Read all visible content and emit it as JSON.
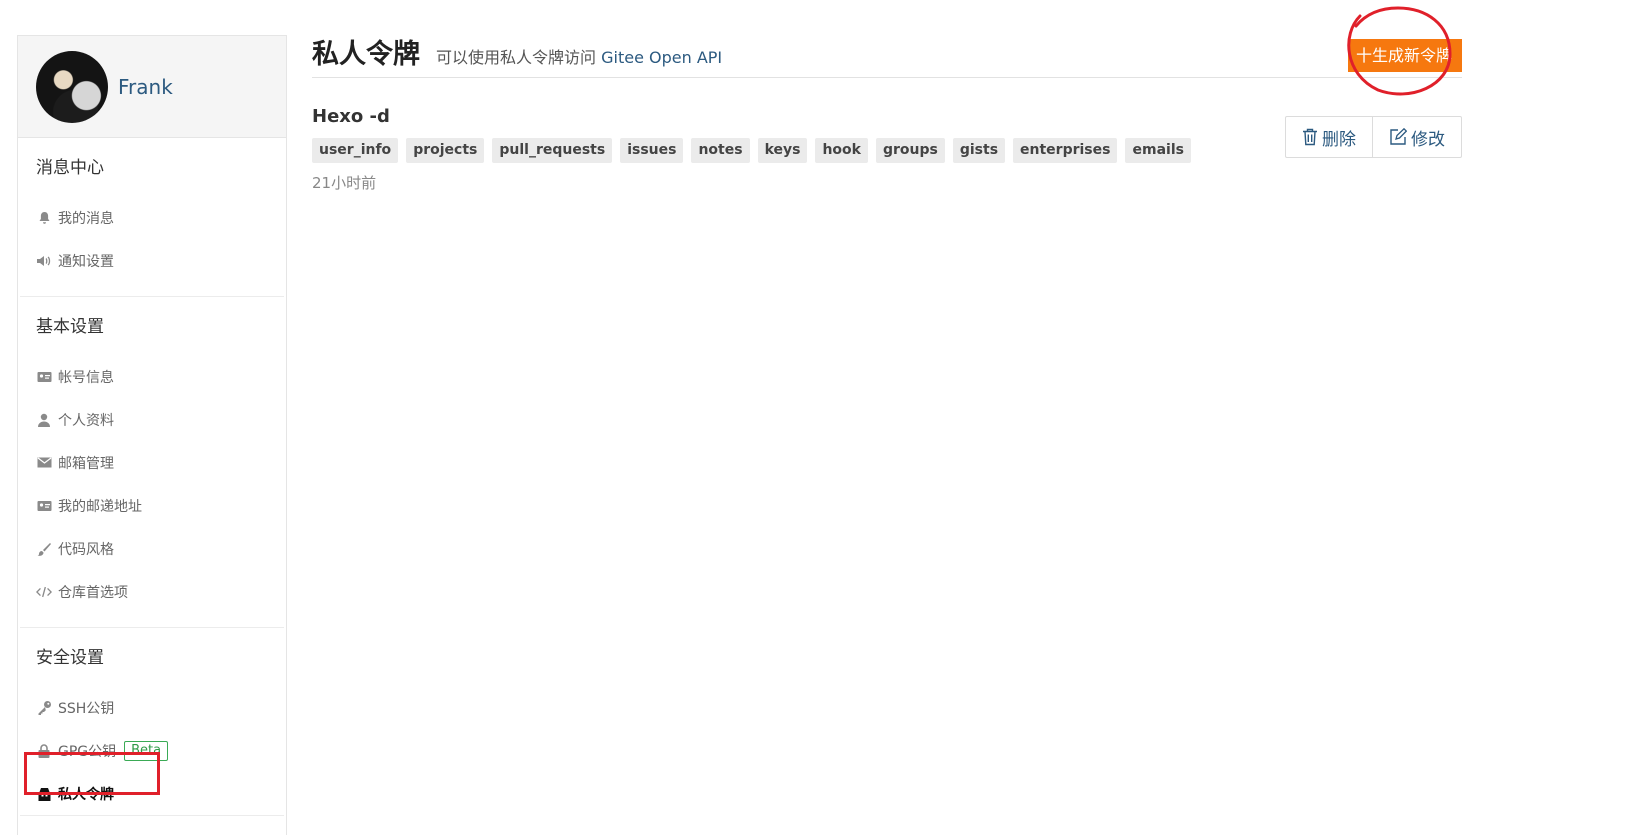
{
  "user": {
    "name": "Frank"
  },
  "sidebar": {
    "sections": [
      {
        "title": "消息中心",
        "items": [
          {
            "label": "我的消息",
            "icon": "bell-icon"
          },
          {
            "label": "通知设置",
            "icon": "speaker-icon"
          }
        ]
      },
      {
        "title": "基本设置",
        "items": [
          {
            "label": "帐号信息",
            "icon": "id-card-icon"
          },
          {
            "label": "个人资料",
            "icon": "user-icon"
          },
          {
            "label": "邮箱管理",
            "icon": "envelope-icon"
          },
          {
            "label": "我的邮递地址",
            "icon": "address-card-icon"
          },
          {
            "label": "代码风格",
            "icon": "brush-icon"
          },
          {
            "label": "仓库首选项",
            "icon": "code-icon"
          }
        ]
      },
      {
        "title": "安全设置",
        "items": [
          {
            "label": "SSH公钥",
            "icon": "key-icon"
          },
          {
            "label": "GPG公钥",
            "icon": "lock-icon",
            "badge": "Beta"
          },
          {
            "label": "私人令牌",
            "icon": "token-icon",
            "active": true
          }
        ]
      }
    ]
  },
  "header": {
    "title": "私人令牌",
    "subtitle_prefix": "可以使用私人令牌访问",
    "subtitle_link": "Gitee Open API",
    "generate_button": "十生成新令牌"
  },
  "tokens": [
    {
      "name": "Hexo -d",
      "scopes": [
        "user_info",
        "projects",
        "pull_requests",
        "issues",
        "notes",
        "keys",
        "hook",
        "groups",
        "gists",
        "enterprises",
        "emails"
      ],
      "time": "21小时前",
      "delete_label": "删除",
      "edit_label": "修改"
    }
  ],
  "colors": {
    "accent": "#f6780f",
    "link": "#2c5a80",
    "annotation": "#e0202a",
    "badge": "#3aaa55"
  }
}
